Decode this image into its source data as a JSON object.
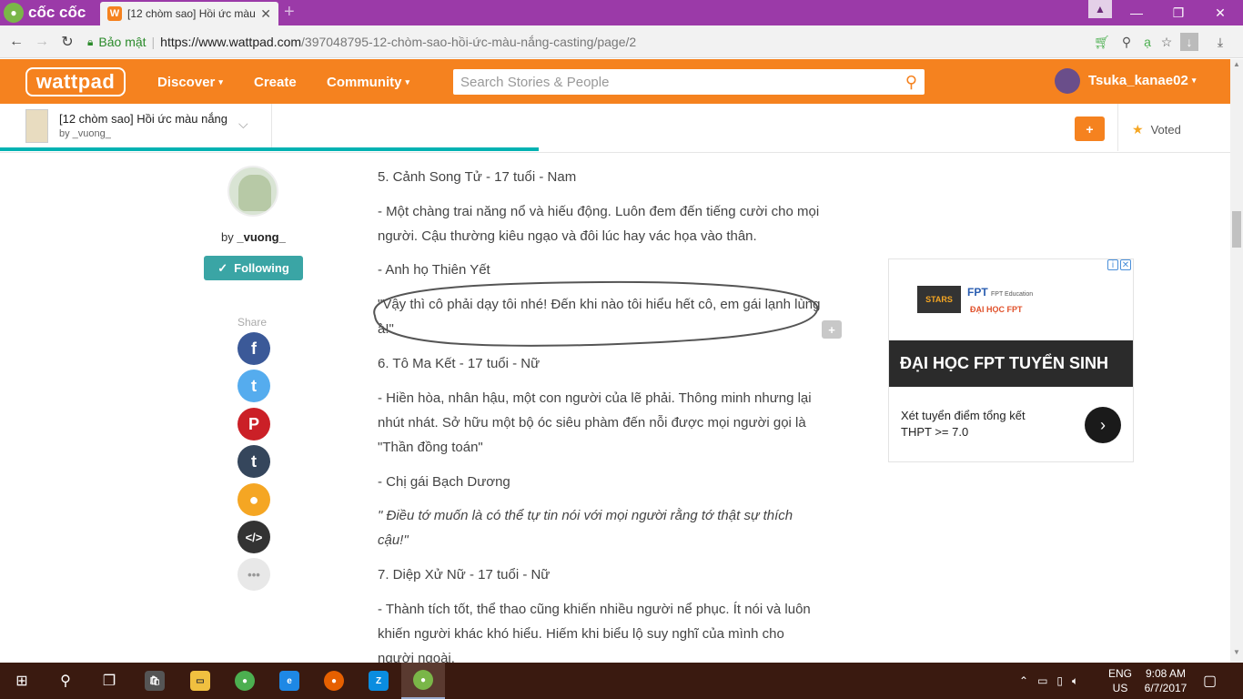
{
  "browser": {
    "brand": "cốc cốc",
    "tab_title": "[12 chòm sao] Hồi ức màu",
    "tab_close": "✕",
    "new_tab": "+",
    "security_label": "Bảo mật",
    "url_host": "https://www.wattpad.com",
    "url_path": "/397048795-12-chòm-sao-hồi-ức-màu-nắng-casting/page/2"
  },
  "header": {
    "logo": "wattpad",
    "nav": [
      {
        "label": "Discover",
        "caret": "▾"
      },
      {
        "label": "Create"
      },
      {
        "label": "Community",
        "caret": "▾"
      }
    ],
    "search_placeholder": "Search Stories & People",
    "username": "Tsuka_kanae02",
    "user_caret": "▾"
  },
  "storybar": {
    "title": "[12 chòm sao] Hồi ức màu nắng",
    "by": "by _vuong_",
    "add_label": "+",
    "voted_label": "Voted"
  },
  "sidebar": {
    "by_prefix": "by",
    "author": "_vuong_",
    "follow_label": "Following",
    "share_label": "Share",
    "share_buttons": [
      {
        "name": "facebook",
        "color": "#3b5998",
        "glyph": "f"
      },
      {
        "name": "twitter",
        "color": "#55acee",
        "glyph": "t"
      },
      {
        "name": "pinterest",
        "color": "#cb2027",
        "glyph": "P"
      },
      {
        "name": "tumblr",
        "color": "#35465c",
        "glyph": "t"
      },
      {
        "name": "profile",
        "color": "#f5a623",
        "glyph": "●"
      },
      {
        "name": "embed",
        "color": "#333333",
        "glyph": "</>"
      },
      {
        "name": "more",
        "color": "#e8e8e8",
        "glyph": "•••"
      }
    ]
  },
  "content": {
    "paragraphs": [
      "5. Cảnh Song Tử - 17 tuổi - Nam",
      "- Một chàng trai năng nổ và hiếu động. Luôn đem đến tiếng cười cho mọi người. Cậu thường kiêu ngạo và đôi lúc hay vác họa vào thân.",
      "- Anh họ Thiên Yết",
      "\"Vậy thì cô phải dạy tôi nhé! Đến khi nào tôi hiểu hết cô, em gái lạnh lùng à!\"",
      "6. Tô Ma Kết - 17 tuổi - Nữ",
      "- Hiền hòa, nhân hậu, một con người của lẽ phải. Thông minh nhưng lại nhút nhát. Sở hữu một bộ óc siêu phàm đến nỗi được mọi người gọi là \"Thần đồng toán\"",
      "- Chị gái Bạch Dương",
      "\" Điều tớ muốn là có thể tự tin nói với mọi người rằng tớ thật sự thích cậu!\"",
      "7. Diệp Xử Nữ - 17 tuổi - Nữ",
      "- Thành tích tốt, thể thao cũng khiến nhiều người nể phục. Ít nói và luôn khiến người khác khó hiểu. Hiếm khi biểu lộ suy nghĩ của mình cho người ngoài."
    ],
    "comment_icon_label": "+"
  },
  "ad": {
    "logo1": "STARS",
    "logo2": "FPT",
    "logo2_sub": "FPT Education",
    "logo3": "ĐẠI HỌC FPT",
    "headline": "ĐẠI HỌC FPT TUYỂN SINH",
    "line1": "Xét tuyển điểm tổng kết",
    "line2": "THPT >= 7.0",
    "arrow": "›",
    "info": "i",
    "close": "✕"
  },
  "taskbar": {
    "lang1": "ENG",
    "lang2": "US",
    "time": "9:08 AM",
    "date": "6/7/2017"
  }
}
